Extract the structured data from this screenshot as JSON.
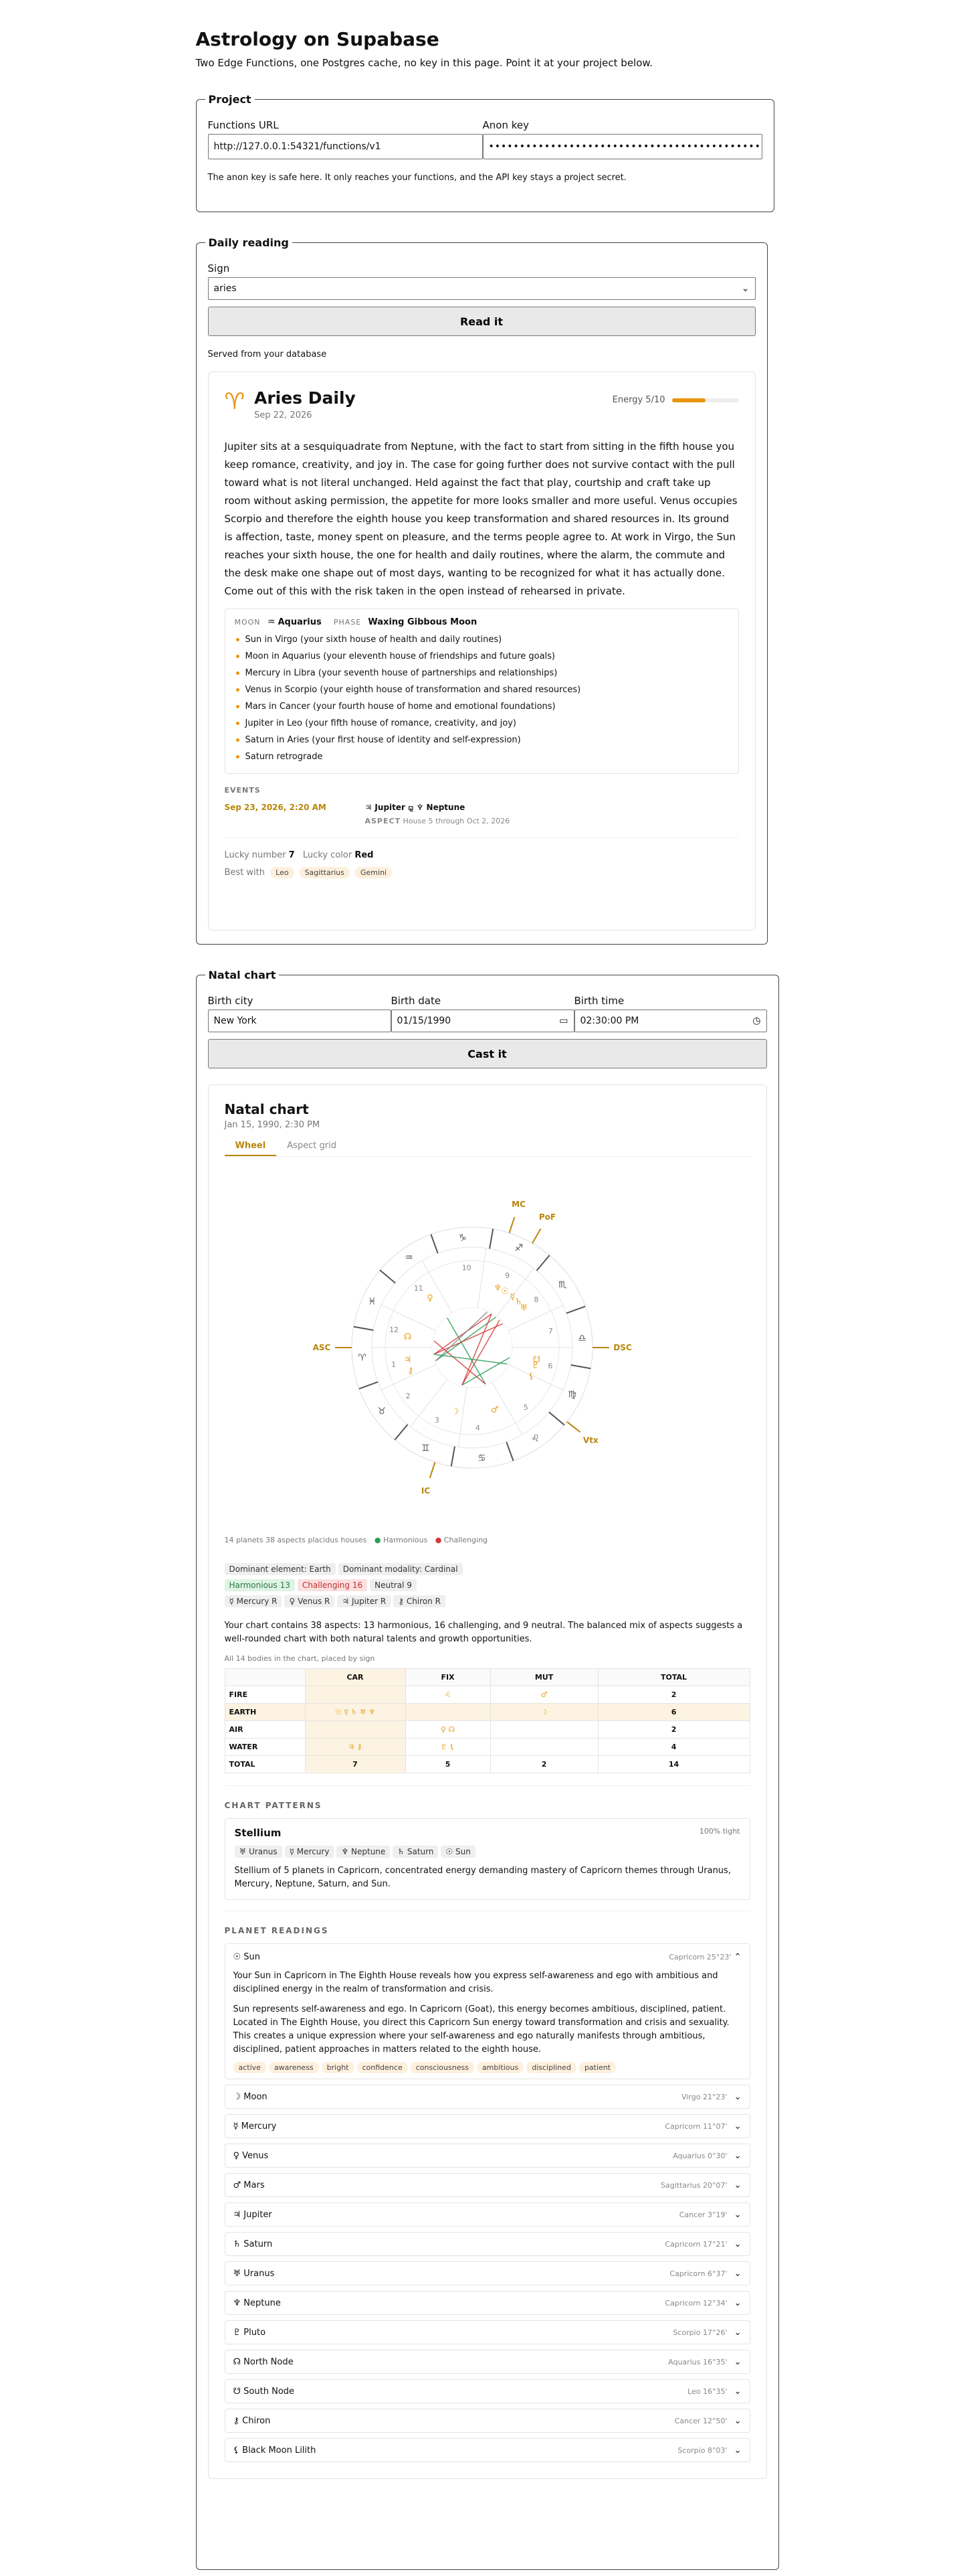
{
  "header": {
    "title": "Astrology on Supabase",
    "intro": "Two Edge Functions, one Postgres cache, no key in this page. Point it at your project below."
  },
  "project": {
    "legend": "Project",
    "functions_label": "Functions URL",
    "functions_value": "http://127.0.0.1:54321/functions/v1",
    "anon_label": "Anon key",
    "anon_value": "••••••••••••••••••••••••••••••••••••••••••••",
    "note": "The anon key is safe here. It only reaches your functions, and the API key stays a project secret."
  },
  "daily": {
    "legend": "Daily reading",
    "sign_label": "Sign",
    "sign_value": "aries",
    "button": "Read it",
    "served": "Served from your database",
    "card": {
      "glyph": "♈",
      "title": "Aries Daily",
      "date": "Sep 22, 2026",
      "energy_label": "Energy 5/10",
      "energy": 0.5,
      "body": "Jupiter sits at a sesquiquadrate from Neptune, with the fact to start from sitting in the fifth house you keep romance, creativity, and joy in. The case for going further does not survive contact with the pull toward what is not literal unchanged. Held against the fact that play, courtship and craft take up room without asking permission, the appetite for more looks smaller and more useful. Venus occupies Scorpio and therefore the eighth house you keep transformation and shared resources in. Its ground is affection, taste, money spent on pleasure, and the terms people agree to. At work in Virgo, the Sun reaches your sixth house, the one for health and daily routines, where the alarm, the commute and the desk make one shape out of most days, wanting to be recognized for what it has actually done. Come out of this with the risk taken in the open instead of rehearsed in private.",
      "moon_label": "MOON",
      "moon_glyph": "♒",
      "moon_value": "Aquarius",
      "phase_label": "PHASE",
      "phase_value": "Waxing Gibbous Moon",
      "transits": [
        "Sun in Virgo (your sixth house of health and daily routines)",
        "Moon in Aquarius (your eleventh house of friendships and future goals)",
        "Mercury in Libra (your seventh house of partnerships and relationships)",
        "Venus in Scorpio (your eighth house of transformation and shared resources)",
        "Mars in Cancer (your fourth house of home and emotional foundations)",
        "Jupiter in Leo (your fifth house of romance, creativity, and joy)",
        "Saturn in Aries (your first house of identity and self-expression)",
        "Saturn retrograde"
      ],
      "events_label": "EVENTS",
      "event_date": "Sep 23, 2026, 2:20 AM",
      "event_title": "♃ Jupiter ⚼ ♆ Neptune",
      "event_aspect_label": "ASPECT",
      "event_house": "House 5",
      "event_through": "through Oct 2, 2026",
      "lucky_number_label": "Lucky number",
      "lucky_number": "7",
      "lucky_color_label": "Lucky color",
      "lucky_color": "Red",
      "best_with_label": "Best with",
      "best_with": [
        "Leo",
        "Sagittarius",
        "Gemini"
      ]
    }
  },
  "natal": {
    "legend": "Natal chart",
    "city_label": "Birth city",
    "city_value": "New York",
    "date_label": "Birth date",
    "date_value": "01/15/1990",
    "time_label": "Birth time",
    "time_value": "02:30:00 PM",
    "button": "Cast it",
    "card": {
      "title": "Natal chart",
      "subtitle": "Jan 15, 1990, 2:30 PM",
      "tab_wheel": "Wheel",
      "tab_grid": "Aspect grid",
      "axes": {
        "mc": "MC",
        "pof": "PoF",
        "asc": "ASC",
        "dsc": "DSC",
        "ic": "IC",
        "vtx": "Vtx"
      },
      "summary": "14 planets   38 aspects   placidus houses",
      "harmonious": "Harmonious",
      "challenging": "Challenging",
      "chips": [
        "Dominant element: Earth",
        "Dominant modality: Cardinal"
      ],
      "chips2": [
        "Harmonious 13",
        "Challenging 16",
        "Neutral 9"
      ],
      "retro": [
        "☿ Mercury R",
        "♀ Venus R",
        "♃ Jupiter R",
        "⚷ Chiron R"
      ],
      "overview": "Your chart contains 38 aspects: 13 harmonious, 16 challenging, and 9 neutral. The balanced mix of aspects suggests a well-rounded chart with both natural talents and growth opportunities.",
      "table_caption": "All 14 bodies in the chart, placed by sign",
      "table_head": [
        "",
        "CAR",
        "FIX",
        "MUT",
        "TOTAL"
      ],
      "table_rows": [
        [
          "FIRE",
          "",
          "♌",
          "♂",
          "2"
        ],
        [
          "EARTH",
          "☉ ☿ ♄ ♅ ♆",
          "",
          "☽",
          "6"
        ],
        [
          "AIR",
          "",
          "♀ ☊",
          "",
          "2"
        ],
        [
          "WATER",
          "♃ ⚷",
          "♇ ⚸",
          "",
          "4"
        ],
        [
          "TOTAL",
          "7",
          "5",
          "2",
          "14"
        ]
      ],
      "patterns_label": "CHART PATTERNS",
      "pattern_title": "Stellium",
      "pattern_tight": "100% tight",
      "pattern_chips": [
        "♅ Uranus",
        "☿ Mercury",
        "♆ Neptune",
        "♄ Saturn",
        "☉ Sun"
      ],
      "pattern_text": "Stellium of 5 planets in Capricorn, concentrated energy demanding mastery of Capricorn themes through Uranus, Mercury, Neptune, Saturn, and Sun.",
      "readings_label": "PLANET READINGS",
      "sun": {
        "name": "☉ Sun",
        "pos": "Capricorn 25°23'",
        "p1": "Your Sun in Capricorn in The Eighth House reveals how you express self-awareness and ego with ambitious and disciplined energy in the realm of transformation and crisis.",
        "p2": "Sun represents self-awareness and ego. In Capricorn (Goat), this energy becomes ambitious, disciplined, patient. Located in The Eighth House, you direct this Capricorn Sun energy toward transformation and crisis and sexuality. This creates a unique expression where your self-awareness and ego naturally manifests through ambitious, disciplined, patient approaches in matters related to the eighth house.",
        "tags": [
          "active",
          "awareness",
          "bright",
          "confidence",
          "consciousness",
          "ambitious",
          "disciplined",
          "patient"
        ]
      },
      "planets": [
        [
          "☽ Moon",
          "Virgo 21°23'"
        ],
        [
          "☿ Mercury",
          "Capricorn 11°07'"
        ],
        [
          "♀ Venus",
          "Aquarius 0°30'"
        ],
        [
          "♂ Mars",
          "Sagittarius 20°07'"
        ],
        [
          "♃ Jupiter",
          "Cancer 3°19'"
        ],
        [
          "♄ Saturn",
          "Capricorn 17°21'"
        ],
        [
          "♅ Uranus",
          "Capricorn 6°37'"
        ],
        [
          "♆ Neptune",
          "Capricorn 12°34'"
        ],
        [
          "♇ Pluto",
          "Scorpio 17°26'"
        ],
        [
          "☊ North Node",
          "Aquarius 16°35'"
        ],
        [
          "☋ South Node",
          "Leo 16°35'"
        ],
        [
          "⚷ Chiron",
          "Cancer 12°50'"
        ],
        [
          "⚸ Black Moon Lilith",
          "Scorpio 8°03'"
        ]
      ]
    }
  }
}
